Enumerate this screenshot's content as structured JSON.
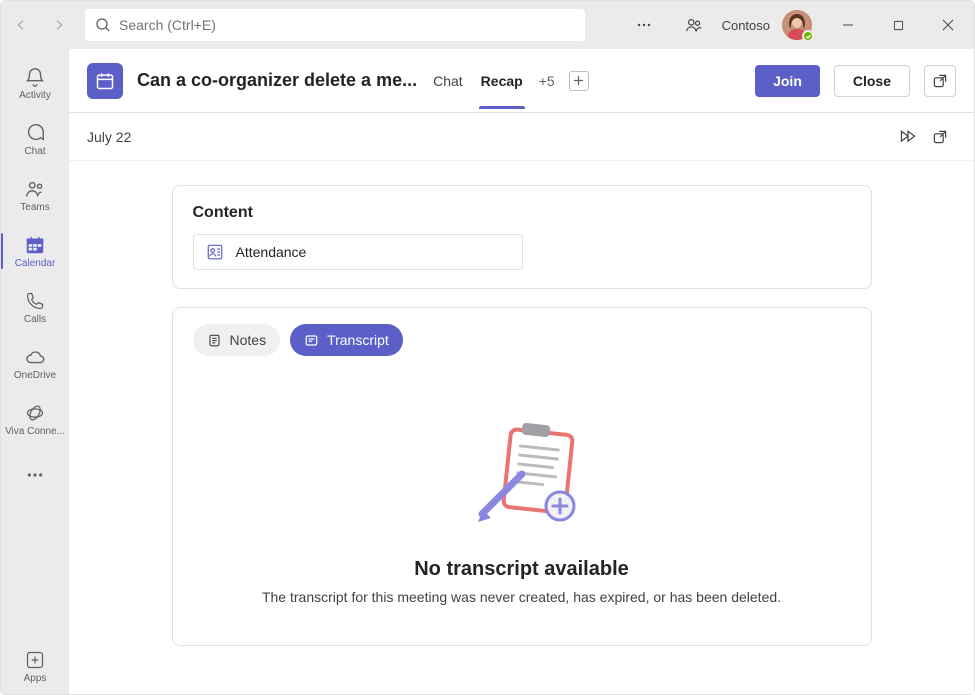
{
  "titlebar": {
    "search_placeholder": "Search (Ctrl+E)",
    "org": "Contoso"
  },
  "rail": {
    "items": [
      {
        "label": "Activity"
      },
      {
        "label": "Chat"
      },
      {
        "label": "Teams"
      },
      {
        "label": "Calendar"
      },
      {
        "label": "Calls"
      },
      {
        "label": "OneDrive"
      },
      {
        "label": "Viva Conne..."
      }
    ],
    "apps_label": "Apps"
  },
  "header": {
    "title": "Can a co-organizer delete a me...",
    "tabs": {
      "chat": "Chat",
      "recap": "Recap",
      "more": "+5"
    },
    "join": "Join",
    "close": "Close"
  },
  "subbar": {
    "date": "July 22"
  },
  "content_card": {
    "heading": "Content",
    "attendance": "Attendance"
  },
  "pills": {
    "notes": "Notes",
    "transcript": "Transcript"
  },
  "empty": {
    "title": "No transcript available",
    "body": "The transcript for this meeting was never created, has expired, or has been deleted."
  }
}
